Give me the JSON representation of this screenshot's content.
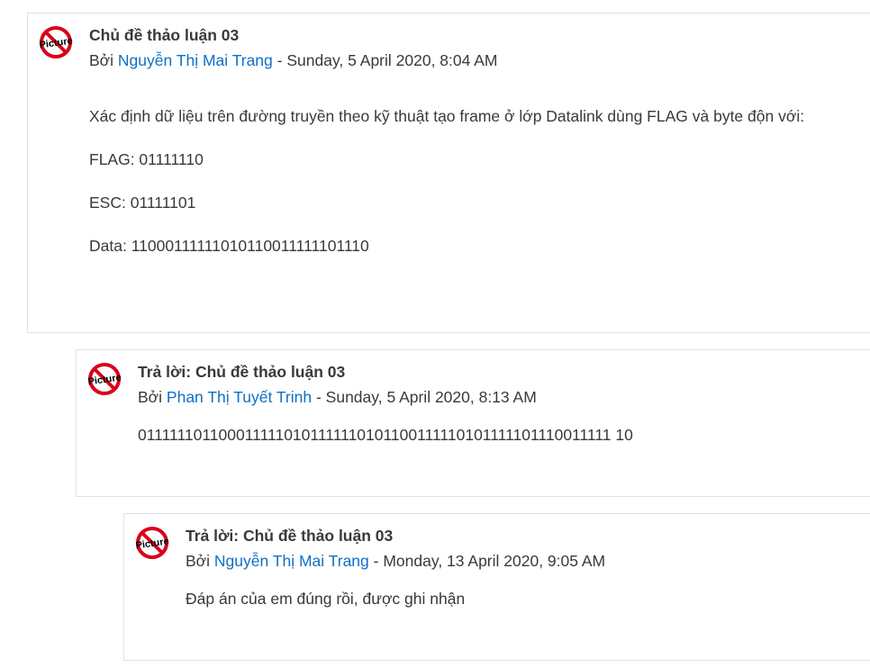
{
  "posts": [
    {
      "subject": "Chủ đề thảo luận 03",
      "by_prefix": "Bởi",
      "author": "Nguyễn Thị Mai Trang",
      "separator": "-",
      "date": "Sunday, 5 April 2020, 8:04 AM",
      "paragraphs": [
        "Xác định dữ liệu trên đường truyền theo kỹ thuật tạo frame ở lớp Datalink dùng FLAG và byte độn với:",
        "FLAG: 01111110",
        "ESC: 01111101",
        "Data: 11000111111010110011111101110"
      ]
    },
    {
      "subject": "Trả lời: Chủ đề thảo luận 03",
      "by_prefix": "Bởi",
      "author": "Phan Thị Tuyết Trinh",
      "separator": "-",
      "date": "Sunday, 5 April 2020, 8:13 AM",
      "paragraphs": [
        "0111111011000111110101111110101100111110101111101110011111 10"
      ]
    },
    {
      "subject": "Trả lời: Chủ đề thảo luận 03",
      "by_prefix": "Bởi",
      "author": "Nguyễn Thị Mai Trang",
      "separator": "-",
      "date": "Monday, 13 April 2020, 9:05 AM",
      "paragraphs": [
        "Đáp án của em đúng rồi, được ghi nhận"
      ]
    }
  ],
  "avatar_icon": "no-picture-icon",
  "avatar_label": "Picture",
  "colors": {
    "link": "#0f6fc5",
    "text": "#373a3c",
    "border": "#dee2e6",
    "avatar_red": "#d9001b"
  }
}
